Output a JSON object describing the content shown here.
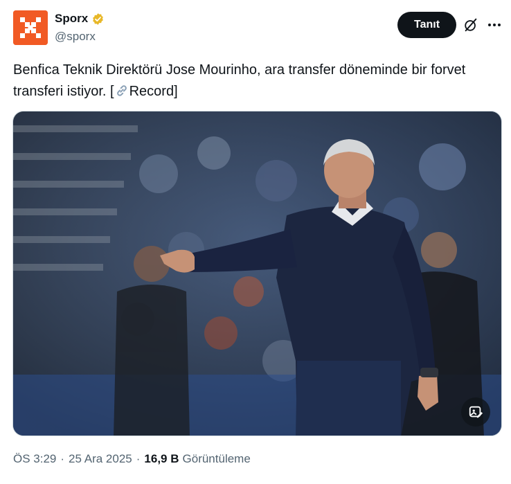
{
  "author": {
    "display_name": "Sporx",
    "handle": "@sporx",
    "avatar": "sporx-logo-icon",
    "verified_badge": "verified-gold-badge-icon",
    "brand_color": "#f15a24"
  },
  "actions": {
    "follow_label": "Tanıt",
    "grok_icon": "grok-icon",
    "more_icon": "more-options-icon"
  },
  "tweet": {
    "text_main": "Benfica Teknik Direktörü Jose Mourinho, ara transfer döneminde bir forvet transferi istiyor. [",
    "link_icon": "link-icon",
    "link_text": "Record",
    "text_end": "]"
  },
  "media": {
    "type": "photo",
    "alt_icon": "image-edit-icon"
  },
  "meta": {
    "time": "ÖS 3:29",
    "separator": "·",
    "date": "25 Ara 2025",
    "views_count": "16,9 B",
    "views_label": "Görüntüleme"
  },
  "colors": {
    "text_primary": "#0f1419",
    "text_secondary": "#536471",
    "button_dark": "#0f1419",
    "verified_gold": "#e8b829"
  }
}
